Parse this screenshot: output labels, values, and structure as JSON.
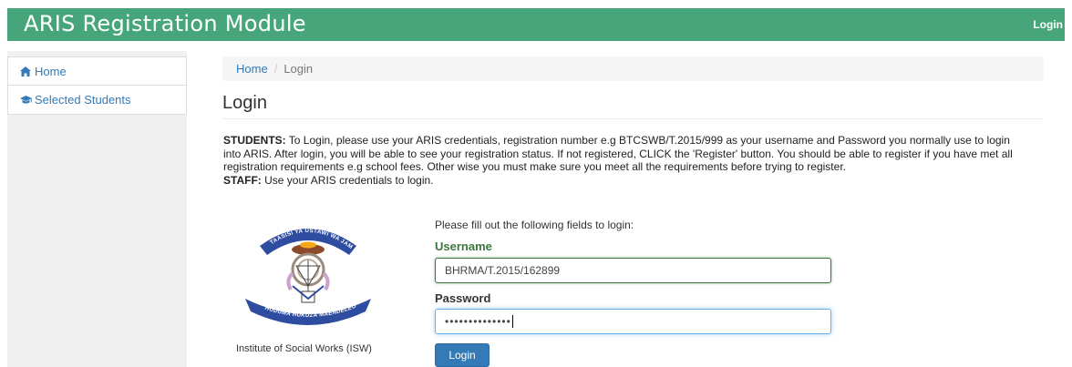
{
  "app": {
    "title": "ARIS Registration Module",
    "top_login_label": "Login"
  },
  "sidebar": {
    "items": [
      {
        "label": "Home",
        "icon": "home-icon"
      },
      {
        "label": "Selected Students",
        "icon": "graduation-cap-icon"
      }
    ]
  },
  "breadcrumb": {
    "home": "Home",
    "separator": "/",
    "current": "Login"
  },
  "page": {
    "title": "Login",
    "students_label": "STUDENTS:",
    "students_text": " To Login, please use your ARIS credentials, registration number e.g BTCSWB/T.2015/999 as your username and Password you normally use to login into ARIS. After login, you will be able to see your registration status. If not registered, CLICK the 'Register' button. You should be able to register if you have met all registration requirements e.g school fees. Other wise you must make sure you meet all the requirements before trying to register.",
    "staff_label": "STAFF:",
    "staff_text": " Use your ARIS credentials to login."
  },
  "logo": {
    "top_text": "TAASISI YA USTAWI WA JAMII",
    "bottom_text": "HUDUMA HUKUZA MAENDELEO",
    "caption": "Institute of Social Works (ISW)"
  },
  "form": {
    "hint": "Please fill out the following fields to login:",
    "username_label": "Username",
    "username_value": "BHRMA/T.2015/162899",
    "password_label": "Password",
    "password_value": "••••••••••••••",
    "submit_label": "Login"
  },
  "colors": {
    "brand_green": "#46a57a",
    "link_blue": "#337ab7",
    "success_green": "#3c763d"
  }
}
